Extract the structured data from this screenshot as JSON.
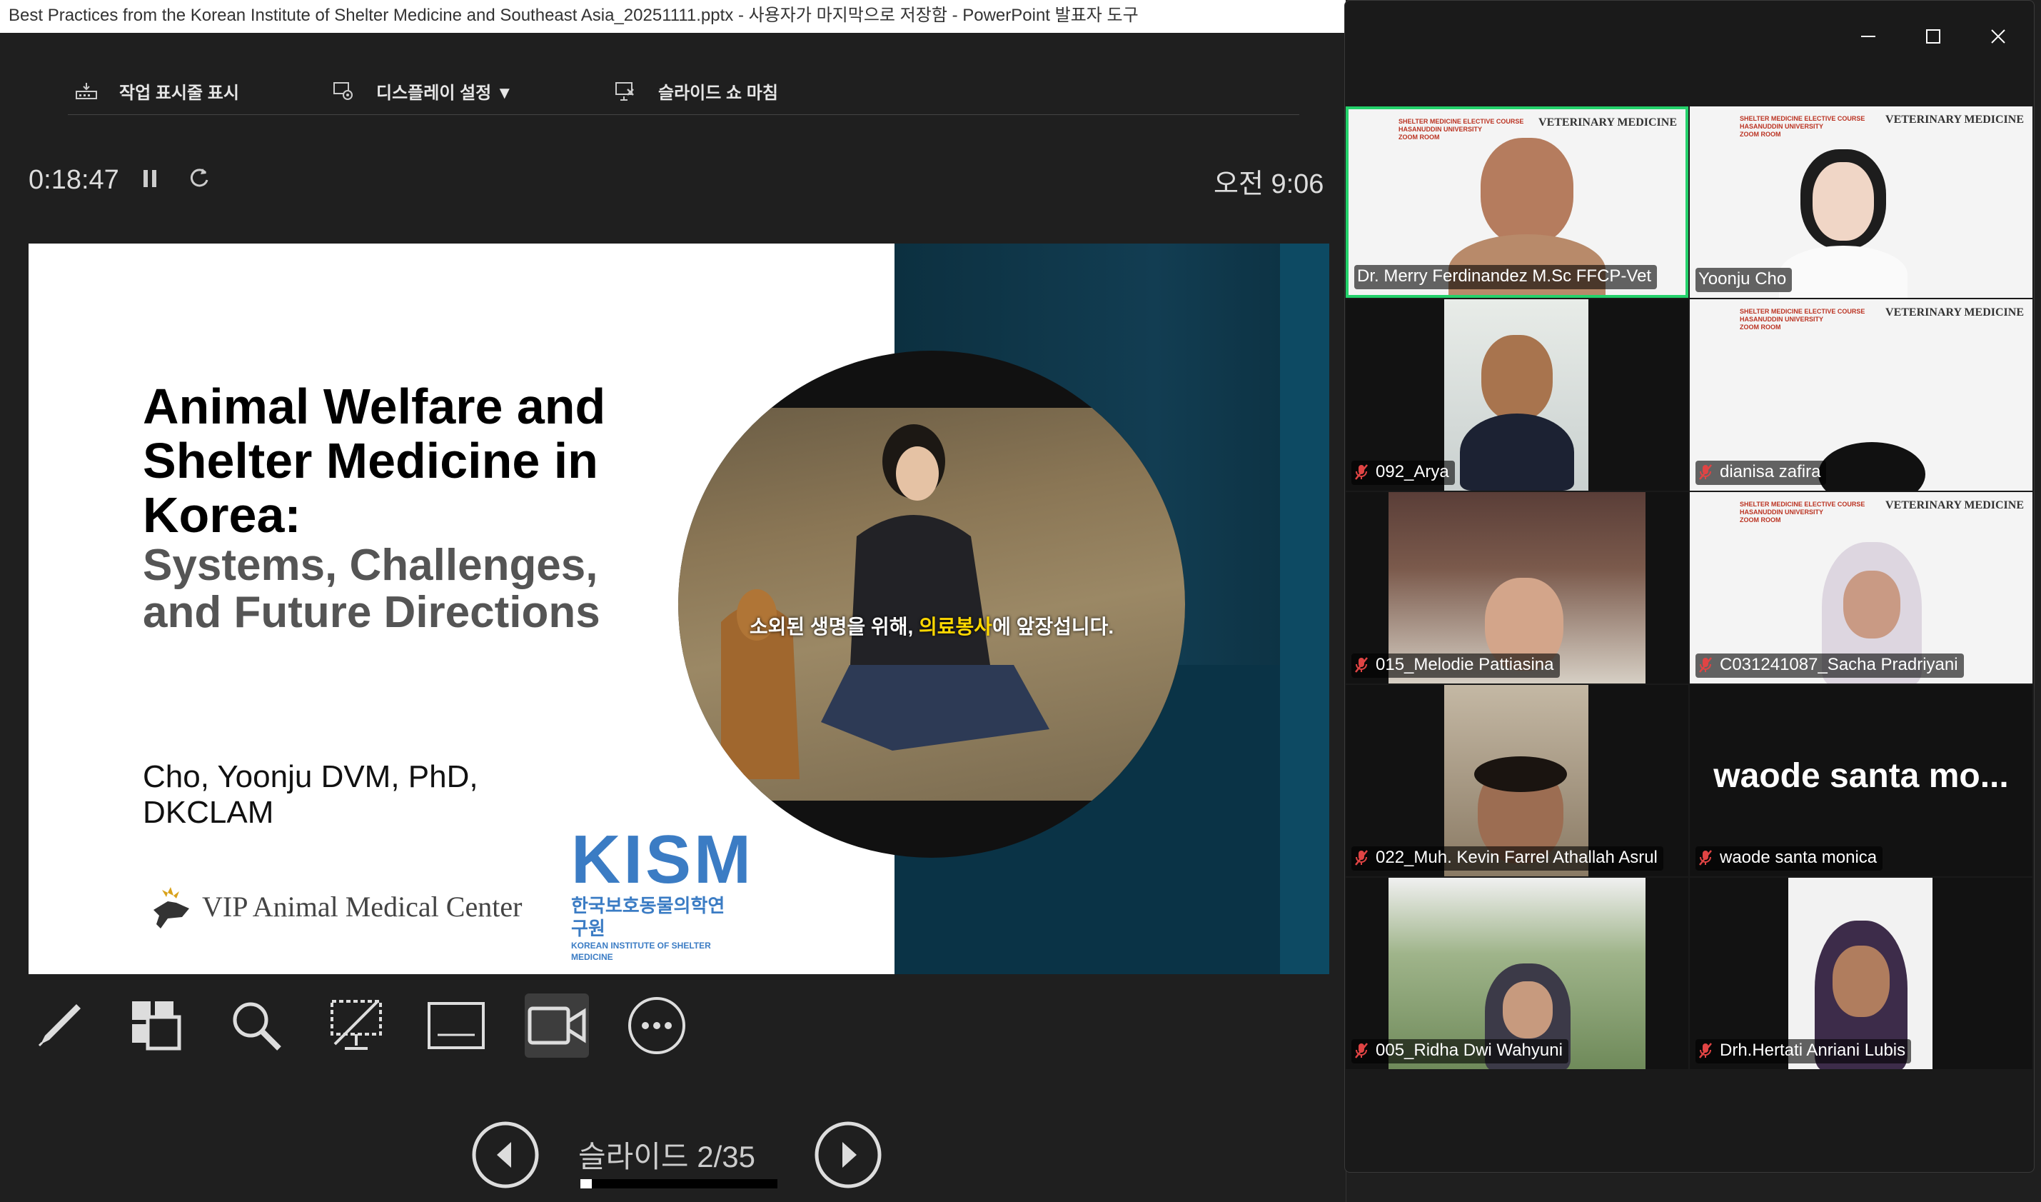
{
  "window": {
    "title": "Best Practices from the Korean Institute of Shelter Medicine and Southeast Asia_20251111.pptx  -  사용자가 마지막으로 저장함 - PowerPoint 발표자 도구"
  },
  "toolbar": {
    "show_taskbar": "작업 표시줄 표시",
    "display_settings": "디스플레이 설정 ▼",
    "end_show": "슬라이드 쇼 마침"
  },
  "timer": {
    "elapsed": "0:18:47",
    "clock": "오전 9:06"
  },
  "slide": {
    "title": "Animal Welfare and Shelter Medicine in Korea:",
    "subtitle": "Systems, Challenges, and Future Directions",
    "author": "Cho, Yoonju DVM, PhD, DKCLAM",
    "vip_logo_text": "VIP Animal Medical Center",
    "kism_logo": "KISM",
    "kism_korean": "한국보호동물의학연구원",
    "kism_english": "KOREAN INSTITUTE OF SHELTER MEDICINE",
    "video_caption_a": "소외된 생명을 위해, ",
    "video_caption_b": "의료봉사",
    "video_caption_c": "에 앞장섭니다."
  },
  "tools": [
    "pen-tool",
    "slides-grid",
    "zoom-magnifier",
    "black-screen",
    "subtitles",
    "camera",
    "more-options"
  ],
  "navigation": {
    "slide_counter": "슬라이드 2/35",
    "current": 2,
    "total": 35,
    "progress_fraction": 0.057
  },
  "zoom": {
    "participants": [
      {
        "name": "Dr. Merry Ferdinandez M.Sc FFCP-Vet",
        "muted": false,
        "active_speaker": true
      },
      {
        "name": "Yoonju Cho",
        "muted": false,
        "active_speaker": false
      },
      {
        "name": "092_Arya",
        "muted": true
      },
      {
        "name": "dianisa zafira",
        "muted": true
      },
      {
        "name": "015_Melodie Pattiasina",
        "muted": true
      },
      {
        "name": "C031241087_Sacha Pradriyani",
        "muted": true
      },
      {
        "name": "022_Muh. Kevin Farrel Athallah Asrul",
        "muted": true
      },
      {
        "name": "waode santa monica",
        "muted": true,
        "display_placeholder": "waode santa mo..."
      },
      {
        "name": "005_Ridha Dwi Wahyuni",
        "muted": true
      },
      {
        "name": "Drh.Hertati Anriani Lubis",
        "muted": true
      }
    ],
    "background_label": "SHELTER MEDICINE ELECTIVE COURSE\nHASANUDDIN UNIVERSITY\nZOOM ROOM",
    "background_logo": "VETERINARY MEDICINE"
  },
  "colors": {
    "active_speaker_border": "#24d16b",
    "kism_blue": "#3b7cc4",
    "muted_red": "#e04444"
  }
}
